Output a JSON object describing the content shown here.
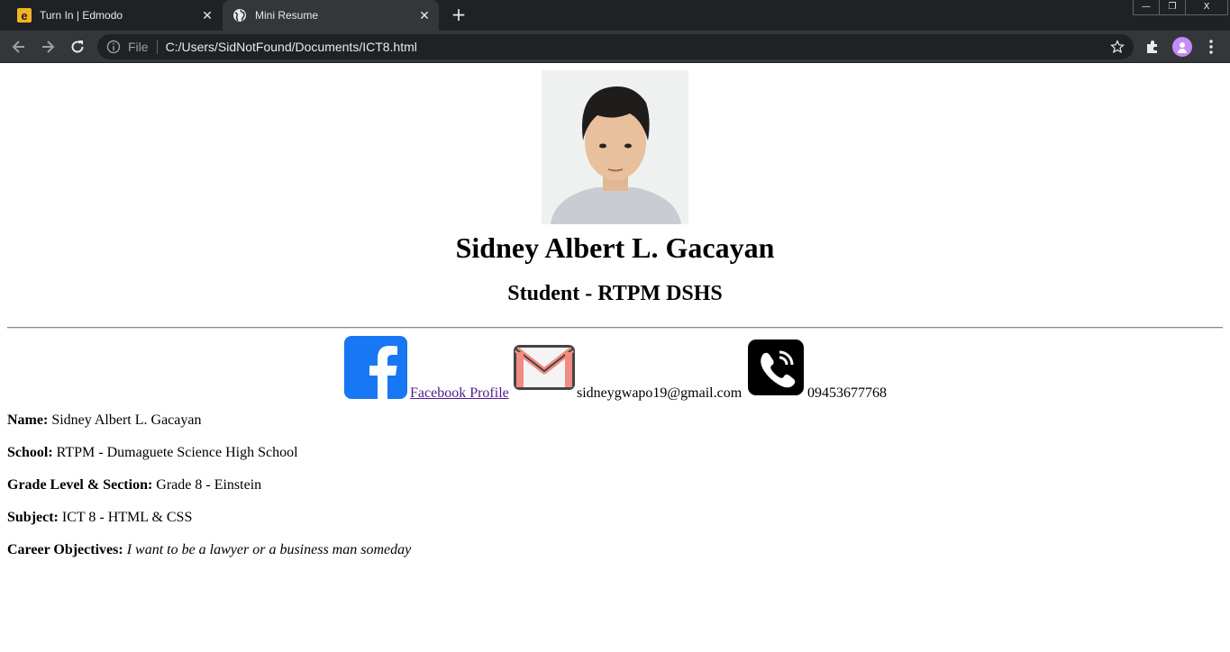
{
  "browser": {
    "tabs": [
      {
        "title": "Turn In | Edmodo",
        "icon": "edmodo-icon",
        "active": false
      },
      {
        "title": "Mini Resume",
        "icon": "globe-icon",
        "active": true
      }
    ],
    "new_tab_label": "+",
    "window_controls": {
      "minimize": "—",
      "restore": "❐",
      "close": "X"
    },
    "address_bar": {
      "scheme_label": "File",
      "url": "C:/Users/SidNotFound/Documents/ICT8.html"
    }
  },
  "page": {
    "name": "Sidney Albert L. Gacayan",
    "role": "Student - RTPM DSHS",
    "contacts": {
      "facebook_label": "Facebook Profile ",
      "email": "sidneygwapo19@gmail.com",
      "phone": "09453677768"
    },
    "info": [
      {
        "label": "Name:",
        "value": "Sidney Albert L. Gacayan"
      },
      {
        "label": "School:",
        "value": "RTPM - Dumaguete Science High School"
      },
      {
        "label": "Grade Level & Section:",
        "value": "Grade 8 - Einstein"
      },
      {
        "label": "Subject:",
        "value": "ICT 8 - HTML & CSS"
      },
      {
        "label": "Career Objectives:",
        "value": "I want to be a lawyer or a business man someday"
      }
    ]
  },
  "colors": {
    "chrome_dark": "#202124",
    "chrome_toolbar": "#35363a",
    "facebook_blue": "#1877f2",
    "link_visited": "#551a8b"
  }
}
